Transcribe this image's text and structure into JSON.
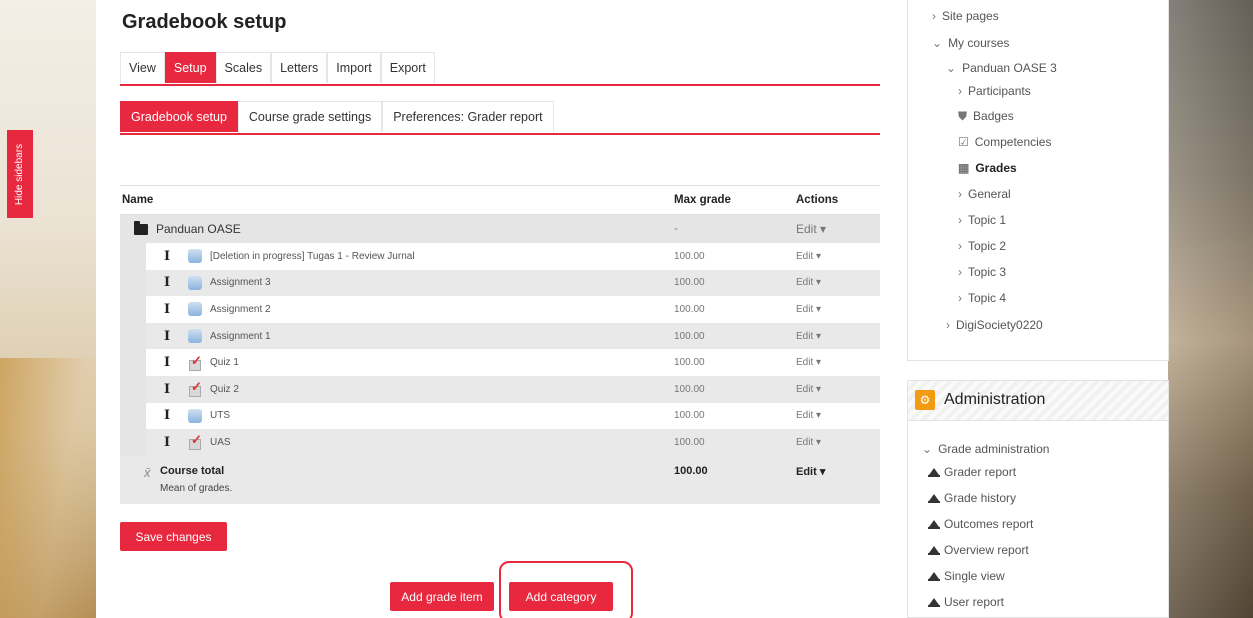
{
  "sidebar_toggle": {
    "label": "Hide sidebars"
  },
  "page": {
    "title": "Gradebook setup"
  },
  "tabs_primary": [
    {
      "label": "View",
      "active": false
    },
    {
      "label": "Setup",
      "active": true
    },
    {
      "label": "Scales",
      "active": false
    },
    {
      "label": "Letters",
      "active": false
    },
    {
      "label": "Import",
      "active": false
    },
    {
      "label": "Export",
      "active": false
    }
  ],
  "tabs_secondary": [
    {
      "label": "Gradebook setup",
      "active": true
    },
    {
      "label": "Course grade settings",
      "active": false
    },
    {
      "label": "Preferences: Grader report",
      "active": false
    }
  ],
  "table": {
    "headers": {
      "name": "Name",
      "max_grade": "Max grade",
      "actions": "Actions"
    },
    "category": {
      "name": "Panduan OASE",
      "max_grade": "-",
      "action": "Edit ▾"
    },
    "items": [
      {
        "type": "assign-icon",
        "name": "[Deletion in progress] Tugas 1 - Review Jurnal",
        "max_grade": "100.00",
        "action": "Edit ▾"
      },
      {
        "type": "assign-icon",
        "name": "Assignment 3",
        "max_grade": "100.00",
        "action": "Edit ▾"
      },
      {
        "type": "assign-icon",
        "name": "Assignment 2",
        "max_grade": "100.00",
        "action": "Edit ▾"
      },
      {
        "type": "assign-icon",
        "name": "Assignment 1",
        "max_grade": "100.00",
        "action": "Edit ▾"
      },
      {
        "type": "quiz-icon",
        "name": "Quiz 1",
        "max_grade": "100.00",
        "action": "Edit ▾"
      },
      {
        "type": "quiz-icon",
        "name": "Quiz 2",
        "max_grade": "100.00",
        "action": "Edit ▾"
      },
      {
        "type": "assign-icon",
        "name": "UTS",
        "max_grade": "100.00",
        "action": "Edit ▾"
      },
      {
        "type": "quiz-icon",
        "name": "UAS",
        "max_grade": "100.00",
        "action": "Edit ▾"
      }
    ],
    "total": {
      "name": "Course total",
      "sub": "Mean of grades.",
      "max_grade": "100.00",
      "action": "Edit ▾"
    }
  },
  "buttons": {
    "save": "Save changes",
    "add_grade_item": "Add grade item",
    "add_category": "Add category"
  },
  "navigation": {
    "items": [
      {
        "label": "Site pages",
        "chev": "›"
      },
      {
        "label": "My courses",
        "chev": "⌄"
      },
      {
        "label": "Panduan OASE 3",
        "chev": "⌄"
      },
      {
        "label": "Participants",
        "chev": "›"
      },
      {
        "label": "Badges",
        "chev": "⛊"
      },
      {
        "label": "Competencies",
        "chev": "☑"
      },
      {
        "label": "Grades",
        "chev": "▦"
      },
      {
        "label": "General",
        "chev": "›"
      },
      {
        "label": "Topic 1",
        "chev": "›"
      },
      {
        "label": "Topic 2",
        "chev": "›"
      },
      {
        "label": "Topic 3",
        "chev": "›"
      },
      {
        "label": "Topic 4",
        "chev": "›"
      },
      {
        "label": "DigiSociety0220",
        "chev": "›"
      }
    ]
  },
  "administration": {
    "title": "Administration",
    "icon": "⚙",
    "section": "Grade administration",
    "section_chev": "⌄",
    "reports": [
      "Grader report",
      "Grade history",
      "Outcomes report",
      "Overview report",
      "Single view",
      "User report"
    ]
  }
}
